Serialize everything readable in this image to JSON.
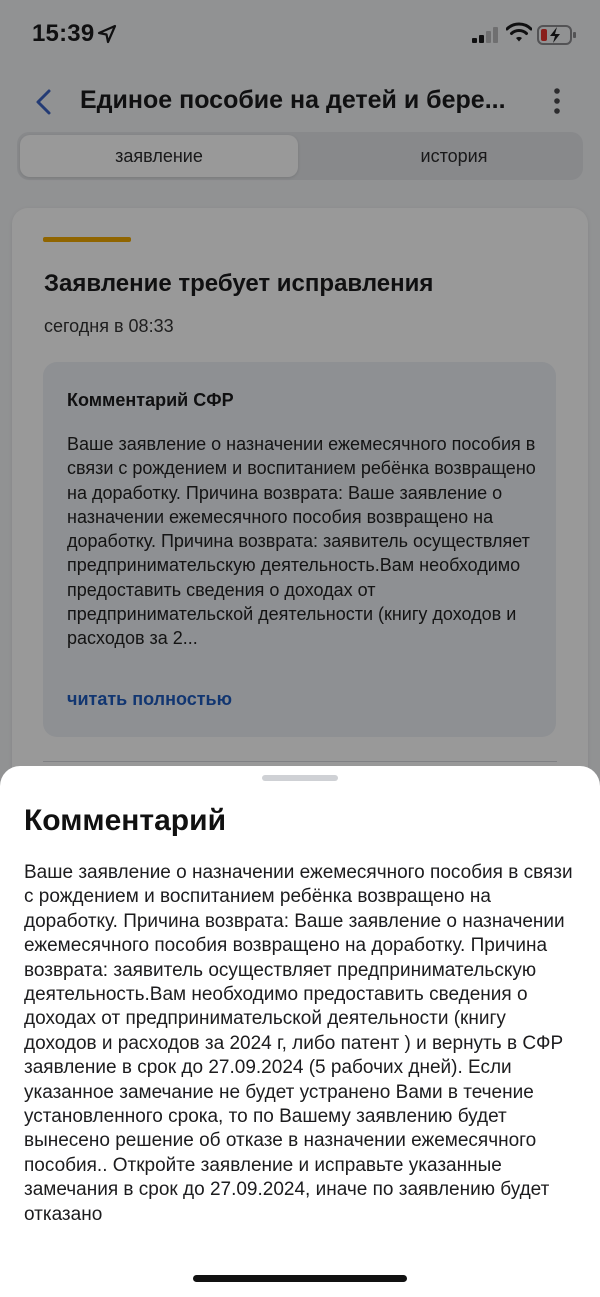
{
  "status_bar": {
    "time": "15:39"
  },
  "nav": {
    "title": "Единое пособие на детей и бере..."
  },
  "tabs": [
    {
      "label": "заявление"
    },
    {
      "label": "история"
    }
  ],
  "card": {
    "title": "Заявление требует исправления",
    "date": "сегодня в 08:33",
    "accent_color": "#f0a800",
    "comment": {
      "heading": "Комментарий СФР",
      "text": "Ваше заявление о назначении ежемесячного пособия в связи с рождением и воспитанием ребёнка возвращено на доработку. Причина возврата: Ваше заявление о назначении ежемесячного пособия возвращено на доработку. Причина возврата: заявитель осуществляет предпринимательскую деятельность.Вам необходимо предоставить сведения о доходах от предпринимательской деятельности (книгу доходов и расходов за 2...",
      "read_more": "читать полностью"
    }
  },
  "sheet": {
    "title": "Комментарий",
    "text": "Ваше заявление о назначении ежемесячного пособия в связи с рождением и воспитанием ребёнка возвращено на доработку. Причина возврата: Ваше заявление о назначении ежемесячного пособия возвращено на доработку. Причина возврата: заявитель осуществляет предпринимательскую деятельность.Вам необходимо предоставить сведения о доходах от предпринимательской деятельности (книгу доходов и расходов за 2024 г, либо патент ) и вернуть в СФР заявление в срок до 27.09.2024 (5 рабочих дней). Если указанное замечание не будет устранено Вами в течение установленного срока, то по Вашему заявлению будет вынесено решение об отказе в назначении ежемесячного пособия.. Откройте заявление и исправьте указанные замечания в срок до 27.09.2024, иначе по заявлению будет отказано"
  }
}
